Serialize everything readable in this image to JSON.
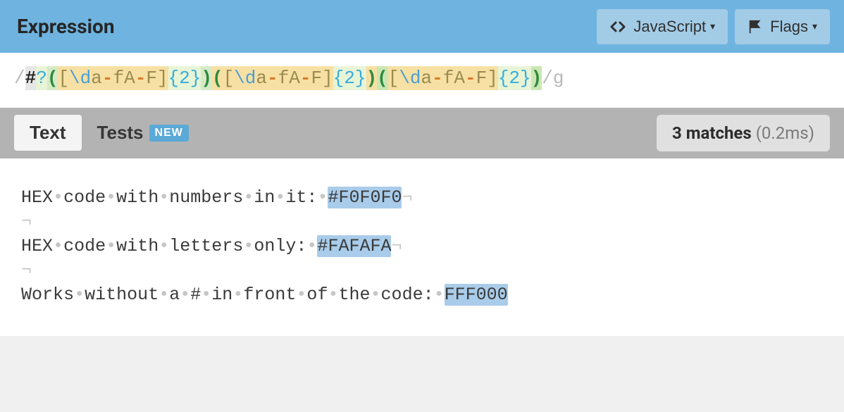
{
  "header": {
    "title": "Expression",
    "js_button": "JavaScript",
    "flags_button": "Flags"
  },
  "expression": {
    "delim_open": "/",
    "delim_close": "/",
    "flag": "g",
    "literal_hash": "#",
    "quant_qmark": "?",
    "paren_open": "(",
    "paren_close": ")",
    "bracket_open": "[",
    "bracket_close": "]",
    "escape_d": "\\d",
    "range_af_lower_a": "a",
    "range_af_lower_f": "f",
    "range_af_upper_a": "A",
    "range_af_upper_f": "F",
    "dash": "-",
    "curly_open": "{",
    "curly_close": "}",
    "curly_n": "2"
  },
  "tabs": {
    "text": "Text",
    "tests": "Tests",
    "tests_badge": "NEW"
  },
  "results": {
    "matches_count": "3 matches",
    "timing": "(0.2ms)"
  },
  "test_text": {
    "line1_pre": "HEX code with numbers in it: ",
    "line1_match": "#F0F0F0",
    "line2_pre": "HEX code with letters only: ",
    "line2_match": "#FAFAFA",
    "line3_pre": "Works without a # in front of the code: ",
    "line3_match": "FFF000",
    "eol": "¬",
    "dot": "•"
  }
}
